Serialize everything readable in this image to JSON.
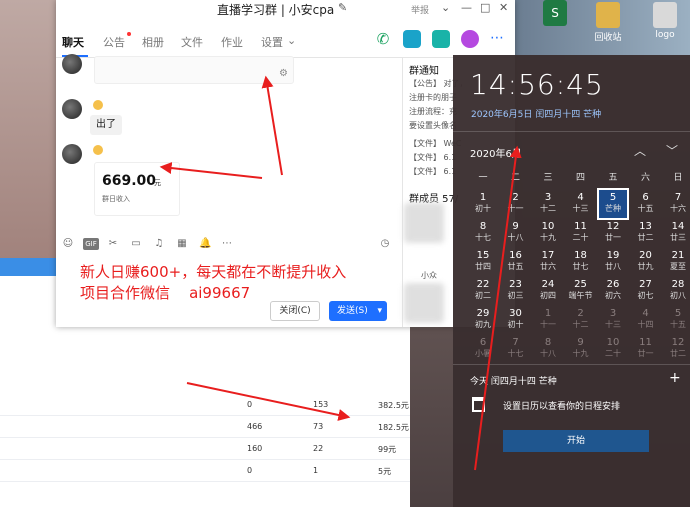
{
  "desktop": {
    "icons": [
      {
        "label": "",
        "glyph": "S"
      },
      {
        "label": "回收站",
        "glyph": ""
      },
      {
        "label": "logo",
        "glyph": ""
      }
    ]
  },
  "chat_window": {
    "title": "直播学习群 | 小安cpa",
    "title_edit_icon": "✎",
    "report": "举报",
    "tabs": [
      "聊天",
      "公告",
      "相册",
      "文件",
      "作业",
      "设置"
    ],
    "messages": {
      "bubble_text": "出了",
      "money_amount": "669.00",
      "money_unit": "元",
      "money_sub": "群日收入"
    },
    "side": {
      "notice_title": "群通知",
      "notice_lines": [
        "【公告】 对了，",
        "注册卡的朋子",
        "注册流程：充",
        "要设置头像名",
        "【文件】 WeC",
        "【文件】 6.1",
        "【文件】 6.1"
      ],
      "members_title": "群成员 57/",
      "member_name": "小众"
    },
    "overlay": "新人日赚600+，每天都在不断提升收入\n项目合作微信    ai99667",
    "buttons": {
      "close": "关闭(C)",
      "send": "发送(S)",
      "send_arrow": "▾"
    },
    "toolbar_icons": [
      "☺",
      "GIF",
      "✂",
      "▭",
      "♫",
      "▦",
      "🔔",
      "⋯"
    ]
  },
  "sheet": {
    "rows": [
      [
        "0",
        "153",
        "382.5元"
      ],
      [
        "466",
        "73",
        "182.5元"
      ],
      [
        "160",
        "22",
        "99元"
      ],
      [
        "0",
        "1",
        "5元"
      ]
    ]
  },
  "calendar": {
    "time": "14:56:45",
    "date_line": "2020年6月5日 闰四月十四 芒种",
    "month": "2020年6月",
    "weekdays": [
      "一",
      "二",
      "三",
      "四",
      "五",
      "六",
      "日"
    ],
    "days": [
      [
        {
          "n": "1",
          "l": "初十"
        },
        {
          "n": "2",
          "l": "十一"
        },
        {
          "n": "3",
          "l": "十二"
        },
        {
          "n": "4",
          "l": "十三"
        },
        {
          "n": "5",
          "l": "芒种"
        },
        {
          "n": "6",
          "l": "十五"
        },
        {
          "n": "7",
          "l": "十六"
        }
      ],
      [
        {
          "n": "8",
          "l": "十七"
        },
        {
          "n": "9",
          "l": "十八"
        },
        {
          "n": "10",
          "l": "十九"
        },
        {
          "n": "11",
          "l": "二十"
        },
        {
          "n": "12",
          "l": "廿一"
        },
        {
          "n": "13",
          "l": "廿二"
        },
        {
          "n": "14",
          "l": "廿三"
        }
      ],
      [
        {
          "n": "15",
          "l": "廿四"
        },
        {
          "n": "16",
          "l": "廿五"
        },
        {
          "n": "17",
          "l": "廿六"
        },
        {
          "n": "18",
          "l": "廿七"
        },
        {
          "n": "19",
          "l": "廿八"
        },
        {
          "n": "20",
          "l": "廿九"
        },
        {
          "n": "21",
          "l": "夏至"
        }
      ],
      [
        {
          "n": "22",
          "l": "初二"
        },
        {
          "n": "23",
          "l": "初三"
        },
        {
          "n": "24",
          "l": "初四"
        },
        {
          "n": "25",
          "l": "端午节"
        },
        {
          "n": "26",
          "l": "初六"
        },
        {
          "n": "27",
          "l": "初七"
        },
        {
          "n": "28",
          "l": "初八"
        }
      ],
      [
        {
          "n": "29",
          "l": "初九"
        },
        {
          "n": "30",
          "l": "初十"
        },
        {
          "n": "1",
          "l": "十一"
        },
        {
          "n": "2",
          "l": "十二"
        },
        {
          "n": "3",
          "l": "十三"
        },
        {
          "n": "4",
          "l": "十四"
        },
        {
          "n": "5",
          "l": "十五"
        }
      ],
      [
        {
          "n": "6",
          "l": "小暑"
        },
        {
          "n": "7",
          "l": "十七"
        },
        {
          "n": "8",
          "l": "十八"
        },
        {
          "n": "9",
          "l": "十九"
        },
        {
          "n": "10",
          "l": "二十"
        },
        {
          "n": "11",
          "l": "廿一"
        },
        {
          "n": "12",
          "l": "廿二"
        }
      ]
    ],
    "event_date": "今天 闰四月十四 芒种",
    "event_text": "设置日历以查看你的日程安排",
    "start_button": "开始",
    "plus": "+",
    "nav_up": "︿",
    "nav_down": "﹀"
  }
}
